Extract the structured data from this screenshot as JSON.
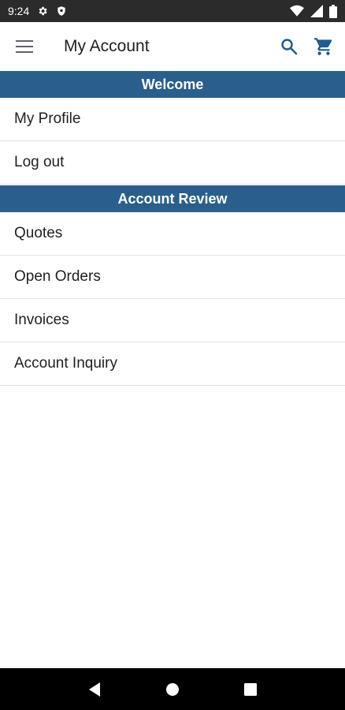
{
  "status_bar": {
    "time": "9:24",
    "icons": [
      "gear-icon",
      "shield-icon",
      "wifi-icon",
      "signal-icon",
      "battery-icon"
    ]
  },
  "app_bar": {
    "title": "My Account",
    "menu_icon": "hamburger-menu-icon",
    "search_icon": "search-icon",
    "cart_icon": "shopping-cart-icon"
  },
  "sections": [
    {
      "title": "Welcome",
      "items": [
        "My Profile",
        "Log out"
      ]
    },
    {
      "title": "Account Review",
      "items": [
        "Quotes",
        "Open Orders",
        "Invoices",
        "Account Inquiry"
      ]
    }
  ],
  "navigation": {
    "back_icon": "back-triangle-icon",
    "home_icon": "home-circle-icon",
    "recents_icon": "recents-square-icon"
  },
  "colors": {
    "section_header": "#2a5f8c",
    "accent_icon": "#1f5c8f",
    "status_bar": "#2b2b2b",
    "nav_bar": "#000000"
  }
}
